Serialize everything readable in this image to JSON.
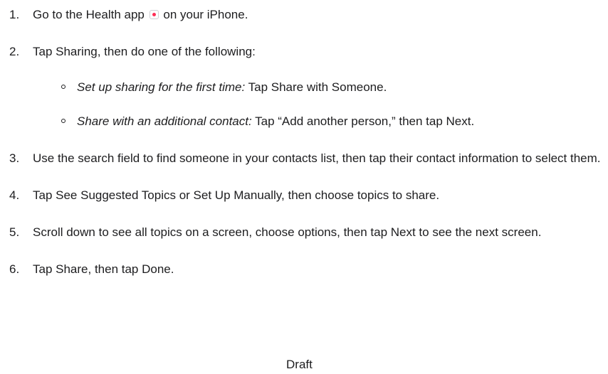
{
  "steps": [
    {
      "number": "1.",
      "text_before_icon": "Go to the Health app",
      "icon": "health-app-icon",
      "text_after_icon": " on your iPhone."
    },
    {
      "number": "2.",
      "text": "Tap Sharing, then do one of the following:",
      "substeps": [
        {
          "lead": "Set up sharing for the first time:",
          "text": " Tap Share with Someone."
        },
        {
          "lead": "Share with an additional contact:",
          "text": " Tap “Add another person,” then tap Next."
        }
      ]
    },
    {
      "number": "3.",
      "text": "Use the search field to find someone in your contacts list, then tap their contact information to select them."
    },
    {
      "number": "4.",
      "text": "Tap See Suggested Topics or Set Up Manually, then choose topics to share."
    },
    {
      "number": "5.",
      "text": "Scroll down to see all topics on a screen, choose options, then tap Next to see the next screen."
    },
    {
      "number": "6.",
      "text": "Tap Share, then tap Done."
    }
  ],
  "cut_off_text": "Draft",
  "colors": {
    "text": "#1d1d1f",
    "health_icon_heart": "#ff2d55"
  }
}
